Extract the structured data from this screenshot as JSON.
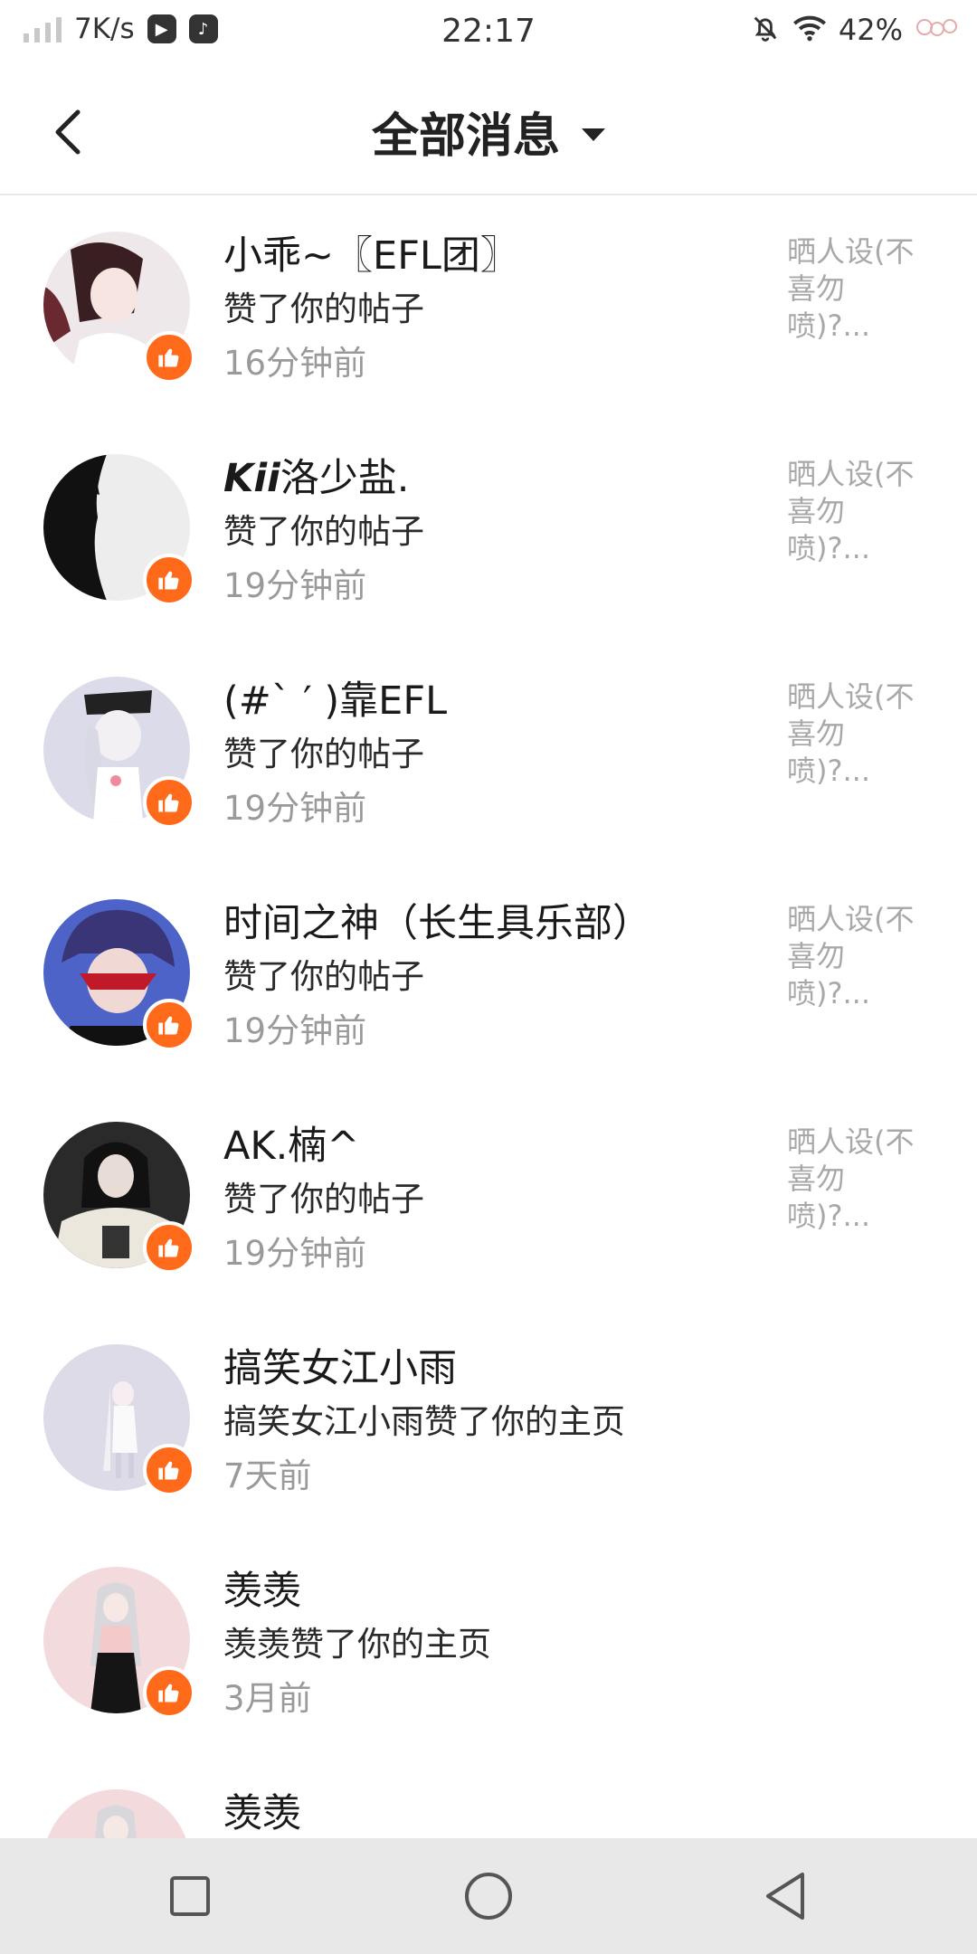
{
  "status_bar": {
    "net_speed": "7K/s",
    "time": "22:17",
    "battery": "42%",
    "icons": [
      "signal-icon",
      "media-play-icon",
      "tiktok-icon",
      "mute-bell-icon",
      "wifi-icon",
      "sticker-icon"
    ]
  },
  "header": {
    "title": "全部消息",
    "back_icon": "chevron-left-icon",
    "dropdown_icon": "caret-down-icon"
  },
  "colors": {
    "like_badge": "#ff6a1a",
    "secondary_text": "#9a9a9a",
    "preview_text": "#a8a8a8"
  },
  "notifications": [
    {
      "name": "小乖~〖EFL团〗",
      "name_prefix": "",
      "action": "赞了你的帖子",
      "time": "16分钟前",
      "preview": "晒人设(不喜勿喷)?..."
    },
    {
      "name": "洛少盐.",
      "name_prefix": "Kii",
      "action": "赞了你的帖子",
      "time": "19分钟前",
      "preview": "晒人设(不喜勿喷)?..."
    },
    {
      "name": "(#`  ′ )靠EFL",
      "name_prefix": "",
      "action": "赞了你的帖子",
      "time": "19分钟前",
      "preview": "晒人设(不喜勿喷)?..."
    },
    {
      "name": "时间之神（长生具乐部）",
      "name_prefix": "",
      "action": "赞了你的帖子",
      "time": "19分钟前",
      "preview": "晒人设(不喜勿喷)?..."
    },
    {
      "name": "AK.楠^",
      "name_prefix": "",
      "action": "赞了你的帖子",
      "time": "19分钟前",
      "preview": "晒人设(不喜勿喷)?..."
    },
    {
      "name": "搞笑女江小雨",
      "name_prefix": "",
      "action": "搞笑女江小雨赞了你的主页",
      "time": "7天前",
      "preview": ""
    },
    {
      "name": "羡羡",
      "name_prefix": "",
      "action": "羡羡赞了你的主页",
      "time": "3月前",
      "preview": ""
    },
    {
      "name": "羡羡",
      "name_prefix": "",
      "action": "",
      "time": "",
      "preview": ""
    }
  ],
  "nav_bar": {
    "buttons": [
      "recents-square-icon",
      "home-circle-icon",
      "back-triangle-icon"
    ]
  }
}
